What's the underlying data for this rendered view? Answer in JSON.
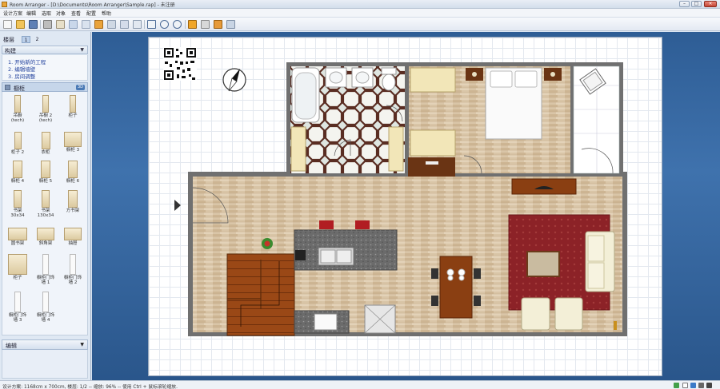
{
  "window": {
    "title": "Room Arranger - [D:\\Documents\\Room Arranger\\Sample.rap] - 未注册"
  },
  "menu": [
    "设计方案",
    "编辑",
    "选取",
    "对象",
    "查看",
    "配置",
    "帮助"
  ],
  "toolbar": {
    "buttons": [
      "new-icon",
      "open-icon",
      "save-icon",
      "print-icon",
      "copy-icon",
      "paint-icon",
      "measure-icon",
      "undo-icon",
      "redo-icon",
      "grid-icon",
      "zoom-fit-icon",
      "zoom-in-icon",
      "zoom-out-icon",
      "2d-view-icon",
      "3d-view-icon",
      "3d-object-icon",
      "walk-icon"
    ]
  },
  "left": {
    "floors_label": "楼层",
    "floor_tabs": [
      "1",
      "2"
    ],
    "build_title": "构建",
    "build_steps": [
      "1. 开始新的工程",
      "2. 编辑墙壁",
      "3. 房间调整"
    ],
    "cabinet_title": "橱柜",
    "cabinet_badge": "3D",
    "cabinets": [
      {
        "l1": "吊橱",
        "l2": "(tech)"
      },
      {
        "l1": "吊橱 2",
        "l2": "(tech)"
      },
      {
        "l1": "柜子",
        "l2": ""
      },
      {
        "l1": "柜子 2",
        "l2": ""
      },
      {
        "l1": "衣柜",
        "l2": ""
      },
      {
        "l1": "橱柜 3",
        "l2": ""
      },
      {
        "l1": "橱柜 4",
        "l2": ""
      },
      {
        "l1": "橱柜 5",
        "l2": ""
      },
      {
        "l1": "橱柜 6",
        "l2": ""
      },
      {
        "l1": "书架",
        "l2": "30x34"
      },
      {
        "l1": "书架",
        "l2": "130x34"
      },
      {
        "l1": "方书架",
        "l2": ""
      },
      {
        "l1": "圆书架",
        "l2": ""
      },
      {
        "l1": "斜角架",
        "l2": ""
      },
      {
        "l1": "抽屉",
        "l2": ""
      },
      {
        "l1": "柜子",
        "l2": ""
      },
      {
        "l1": "橱柜门饰",
        "l2": "墙 1"
      },
      {
        "l1": "橱柜门饰",
        "l2": "墙 2"
      },
      {
        "l1": "橱柜门饰",
        "l2": "墙 3"
      },
      {
        "l1": "橱柜门饰",
        "l2": "墙 4"
      }
    ],
    "edit_title": "编辑"
  },
  "status": {
    "text": "设计方案: 1168cm x 700cm, 楼层: 1/2 -- 缩放: 96% -- 使用 Ctrl + 鼠标滚轮缩放."
  },
  "colors": {
    "wall": "#6f6f6f",
    "floor_wood": "#d8c3a4",
    "rug": "#8e2426",
    "stairs": "#9a4a1a",
    "counter": "#6e6e6e",
    "workspace": "#3a6aa4"
  }
}
